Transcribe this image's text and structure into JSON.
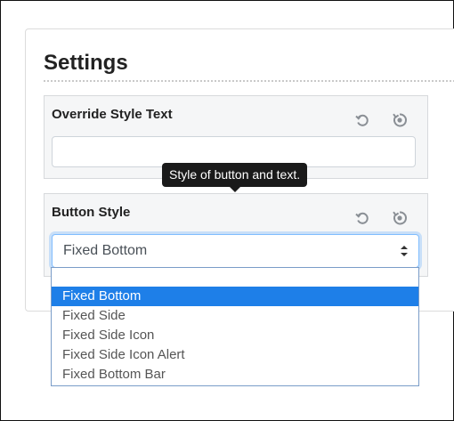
{
  "page": {
    "title": "Settings"
  },
  "sections": [
    {
      "label": "Override Style Text",
      "input_value": "",
      "undo_icon": "undo-icon",
      "reset_icon": "reset-icon"
    },
    {
      "label": "Button Style",
      "select_value": "Fixed Bottom",
      "undo_icon": "undo-icon",
      "reset_icon": "reset-icon"
    }
  ],
  "tooltip": {
    "text": "Style of button and text."
  },
  "dropdown": {
    "options": [
      "Fixed Bottom",
      "Fixed Side",
      "Fixed Side Icon",
      "Fixed Side Icon Alert",
      "Fixed Bottom Bar"
    ],
    "selected_index": 0
  },
  "colors": {
    "highlight": "#1e7fe8",
    "section_bg": "#f5f6f7",
    "focus_border": "#80bdff",
    "tooltip_bg": "#1a1a1a"
  }
}
